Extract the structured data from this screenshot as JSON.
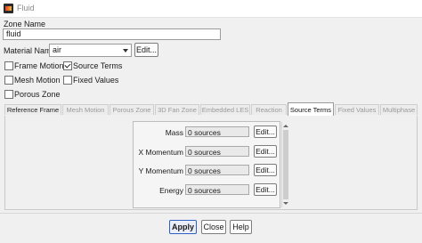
{
  "window": {
    "title": "Fluid",
    "icon": "fluent-app-icon"
  },
  "zone": {
    "label": "Zone Name",
    "value": "fluid"
  },
  "material": {
    "label": "Material Name",
    "selected": "air",
    "edit_label": "Edit..."
  },
  "options": [
    {
      "label": "Frame Motion",
      "checked": false
    },
    {
      "label": "Source Terms",
      "checked": true
    },
    {
      "label": "Mesh Motion",
      "checked": false
    },
    {
      "label": "Fixed Values",
      "checked": false
    },
    {
      "label": "Porous Zone",
      "checked": false
    }
  ],
  "tabs": [
    "Reference Frame",
    "Mesh Motion",
    "Porous Zone",
    "3D Fan Zone",
    "Embedded LES",
    "Reaction",
    "Source Terms",
    "Fixed Values",
    "Multiphase"
  ],
  "active_tab": "Source Terms",
  "source_terms": [
    {
      "label": "Mass",
      "value": "0 sources",
      "edit_label": "Edit..."
    },
    {
      "label": "X Momentum",
      "value": "0 sources",
      "edit_label": "Edit..."
    },
    {
      "label": "Y Momentum",
      "value": "0 sources",
      "edit_label": "Edit..."
    },
    {
      "label": "Energy",
      "value": "0 sources",
      "edit_label": "Edit..."
    }
  ],
  "footer": {
    "apply_label": "Apply",
    "close_label": "Close",
    "help_label": "Help"
  }
}
